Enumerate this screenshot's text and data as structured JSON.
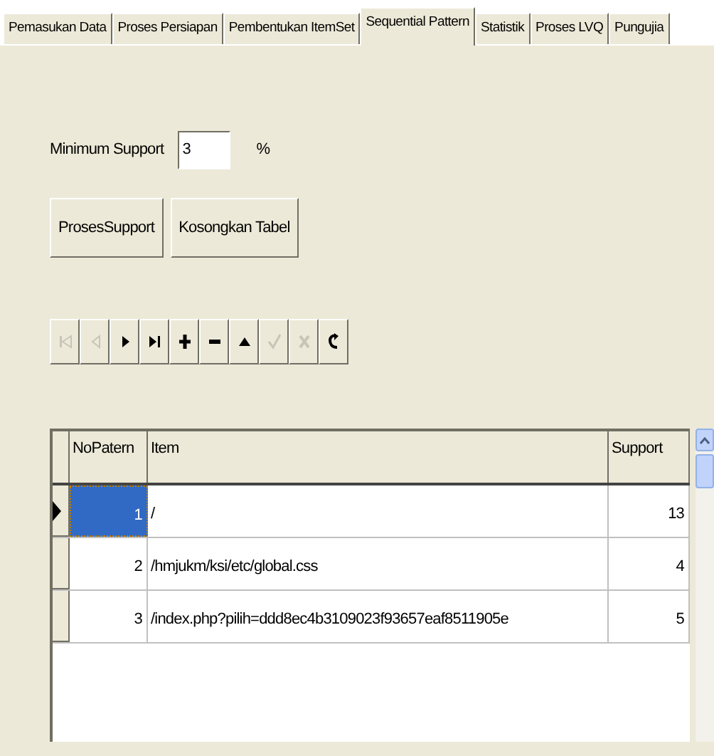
{
  "tabs": [
    {
      "label": "Pemasukan Data",
      "selected": false
    },
    {
      "label": "Proses Persiapan",
      "selected": false
    },
    {
      "label": "Pembentukan ItemSet",
      "selected": false
    },
    {
      "label": "Sequential Pattern",
      "selected": true
    },
    {
      "label": "Statistik",
      "selected": false
    },
    {
      "label": "Proses LVQ",
      "selected": false
    },
    {
      "label": "Pungujia",
      "selected": false
    }
  ],
  "minimum_support": {
    "label": "Minimum Support",
    "value": "3",
    "unit": "%"
  },
  "buttons": [
    "ProsesSupport",
    "Kosongkan Tabel"
  ],
  "navigator": [
    {
      "kind": "first",
      "disabled": true
    },
    {
      "kind": "prior",
      "disabled": true
    },
    {
      "kind": "next",
      "disabled": false
    },
    {
      "kind": "last",
      "disabled": false
    },
    {
      "kind": "insert",
      "disabled": false
    },
    {
      "kind": "delete",
      "disabled": false
    },
    {
      "kind": "edit",
      "disabled": false
    },
    {
      "kind": "post",
      "disabled": true
    },
    {
      "kind": "cancel",
      "disabled": true
    },
    {
      "kind": "refresh",
      "disabled": false
    }
  ],
  "table": {
    "columns": [
      "NoPatern",
      "Item",
      "Support"
    ],
    "rows": [
      {
        "no": "1",
        "item": "/",
        "support": "13",
        "selected": true
      },
      {
        "no": "2",
        "item": "/hmjukm/ksi/etc/global.css",
        "support": "4",
        "selected": false
      },
      {
        "no": "3",
        "item": "/index.php?pilih=ddd8ec4b3109023f93657eaf8511905e",
        "support": "5",
        "selected": false
      }
    ]
  }
}
